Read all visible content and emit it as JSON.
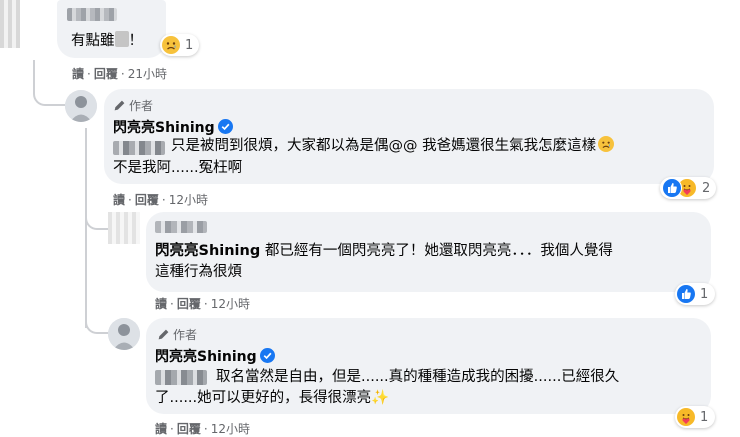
{
  "comment1": {
    "text_visible": "有點雖",
    "text_end": "！",
    "reaction_count": "1",
    "actions": {
      "read": "讀",
      "reply": "回覆",
      "time": "21小時"
    }
  },
  "comment2": {
    "author_tag": "作者",
    "name": "閃亮亮Shining",
    "line1": "只是被問到很煩，大家都以為是偶@@ 我爸媽還很生氣我怎麼這樣",
    "line2": "不是我阿......冤枉啊",
    "reaction_count": "2",
    "actions": {
      "read": "讀",
      "reply": "回覆",
      "time": "12小時"
    }
  },
  "comment3": {
    "mention": "閃亮亮Shining",
    "line1_rest": " 都已經有一個閃亮亮了！她還取閃亮亮．．．我個人覺得",
    "line2": "這種行為很煩",
    "reaction_count": "1",
    "actions": {
      "read": "讀",
      "reply": "回覆",
      "time": "12小時"
    }
  },
  "comment4": {
    "author_tag": "作者",
    "name": "閃亮亮Shining",
    "line1": "取名當然是自由，但是......真的種種造成我的困擾......已經很久",
    "line2": "了......她可以更好的，長得很漂亮",
    "sparkle": "✨",
    "reaction_count": "1",
    "actions": {
      "read": "讀",
      "reply": "回覆",
      "time": "12小時"
    }
  },
  "colors": {
    "bubble": "#f0f2f5",
    "meta_text": "#65676b",
    "verified_blue": "#1877f2",
    "like_blue": "#1877f2",
    "care_yellow": "#f7b928",
    "thread_line": "#ced0d4"
  },
  "icons": [
    "sad-emoji-icon",
    "pencil-icon",
    "verified-badge-icon",
    "like-reaction-icon",
    "care-reaction-icon",
    "sparkles-emoji"
  ]
}
